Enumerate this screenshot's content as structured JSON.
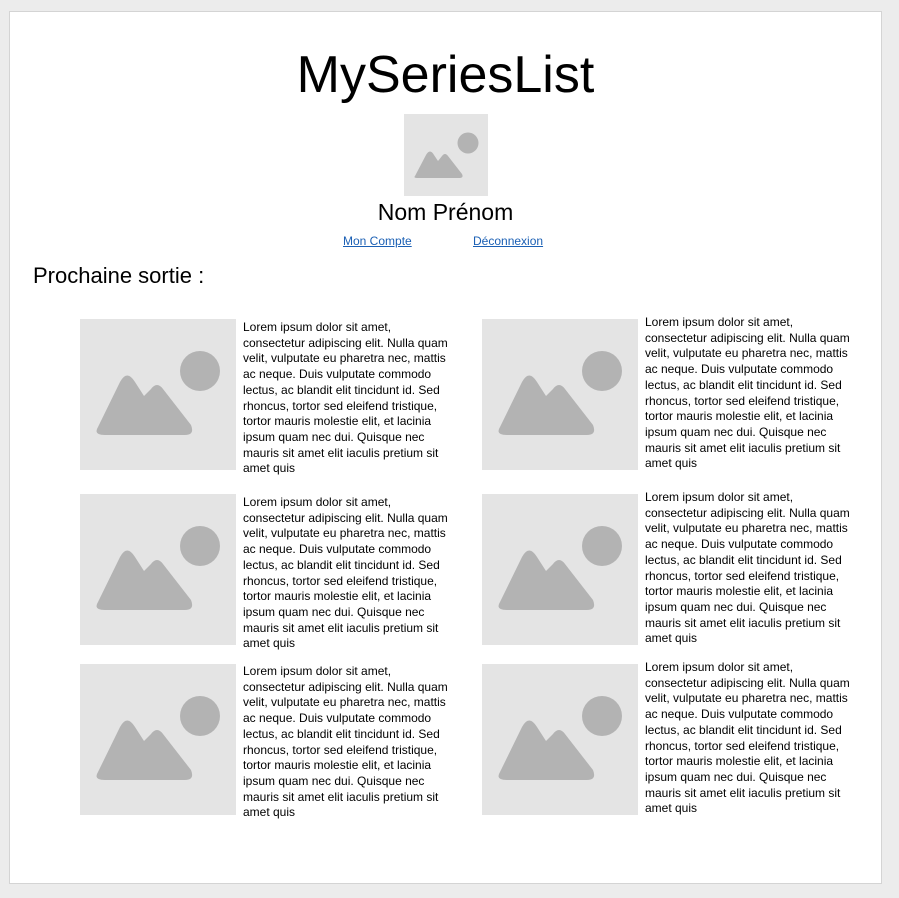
{
  "app": {
    "title": "MySeriesList"
  },
  "user": {
    "name": "Nom Prénom",
    "avatar_icon": "image-placeholder-icon"
  },
  "nav": {
    "account_label": "Mon Compte",
    "logout_label": "Déconnexion"
  },
  "section": {
    "title": "Prochaine sortie :"
  },
  "colors": {
    "placeholder_bg": "#e4e4e4",
    "placeholder_fg": "#b3b3b3",
    "link": "#1a5fb4"
  },
  "releases": [
    {
      "image_icon": "image-placeholder-icon",
      "description": "Lorem ipsum dolor sit amet, consectetur adipiscing elit. Nulla quam velit, vulputate eu pharetra nec, mattis ac neque. Duis vulputate commodo lectus, ac blandit elit tincidunt id. Sed rhoncus, tortor sed eleifend tristique, tortor mauris molestie elit, et lacinia ipsum quam nec dui. Quisque nec mauris sit amet elit iaculis pretium sit amet quis"
    },
    {
      "image_icon": "image-placeholder-icon",
      "description": "Lorem ipsum dolor sit amet, consectetur adipiscing elit. Nulla quam velit, vulputate eu pharetra nec, mattis ac neque. Duis vulputate commodo lectus, ac blandit elit tincidunt id. Sed rhoncus, tortor sed eleifend tristique, tortor mauris molestie elit, et lacinia ipsum quam nec dui. Quisque nec mauris sit amet elit iaculis pretium sit amet quis"
    },
    {
      "image_icon": "image-placeholder-icon",
      "description": "Lorem ipsum dolor sit amet, consectetur adipiscing elit. Nulla quam velit, vulputate eu pharetra nec, mattis ac neque. Duis vulputate commodo lectus, ac blandit elit tincidunt id. Sed rhoncus, tortor sed eleifend tristique, tortor mauris molestie elit, et lacinia ipsum quam nec dui. Quisque nec mauris sit amet elit iaculis pretium sit amet quis"
    },
    {
      "image_icon": "image-placeholder-icon",
      "description": "Lorem ipsum dolor sit amet, consectetur adipiscing elit. Nulla quam velit, vulputate eu pharetra nec, mattis ac neque. Duis vulputate commodo lectus, ac blandit elit tincidunt id. Sed rhoncus, tortor sed eleifend tristique, tortor mauris molestie elit, et lacinia ipsum quam nec dui. Quisque nec mauris sit amet elit iaculis pretium sit amet quis"
    },
    {
      "image_icon": "image-placeholder-icon",
      "description": "Lorem ipsum dolor sit amet, consectetur adipiscing elit. Nulla quam velit, vulputate eu pharetra nec, mattis ac neque. Duis vulputate commodo lectus, ac blandit elit tincidunt id. Sed rhoncus, tortor sed eleifend tristique, tortor mauris molestie elit, et lacinia ipsum quam nec dui. Quisque nec mauris sit amet elit iaculis pretium sit amet quis"
    },
    {
      "image_icon": "image-placeholder-icon",
      "description": "Lorem ipsum dolor sit amet, consectetur adipiscing elit. Nulla quam velit, vulputate eu pharetra nec, mattis ac neque. Duis vulputate commodo lectus, ac blandit elit tincidunt id. Sed rhoncus, tortor sed eleifend tristique, tortor mauris molestie elit, et lacinia ipsum quam nec dui. Quisque nec mauris sit amet elit iaculis pretium sit amet quis"
    }
  ]
}
